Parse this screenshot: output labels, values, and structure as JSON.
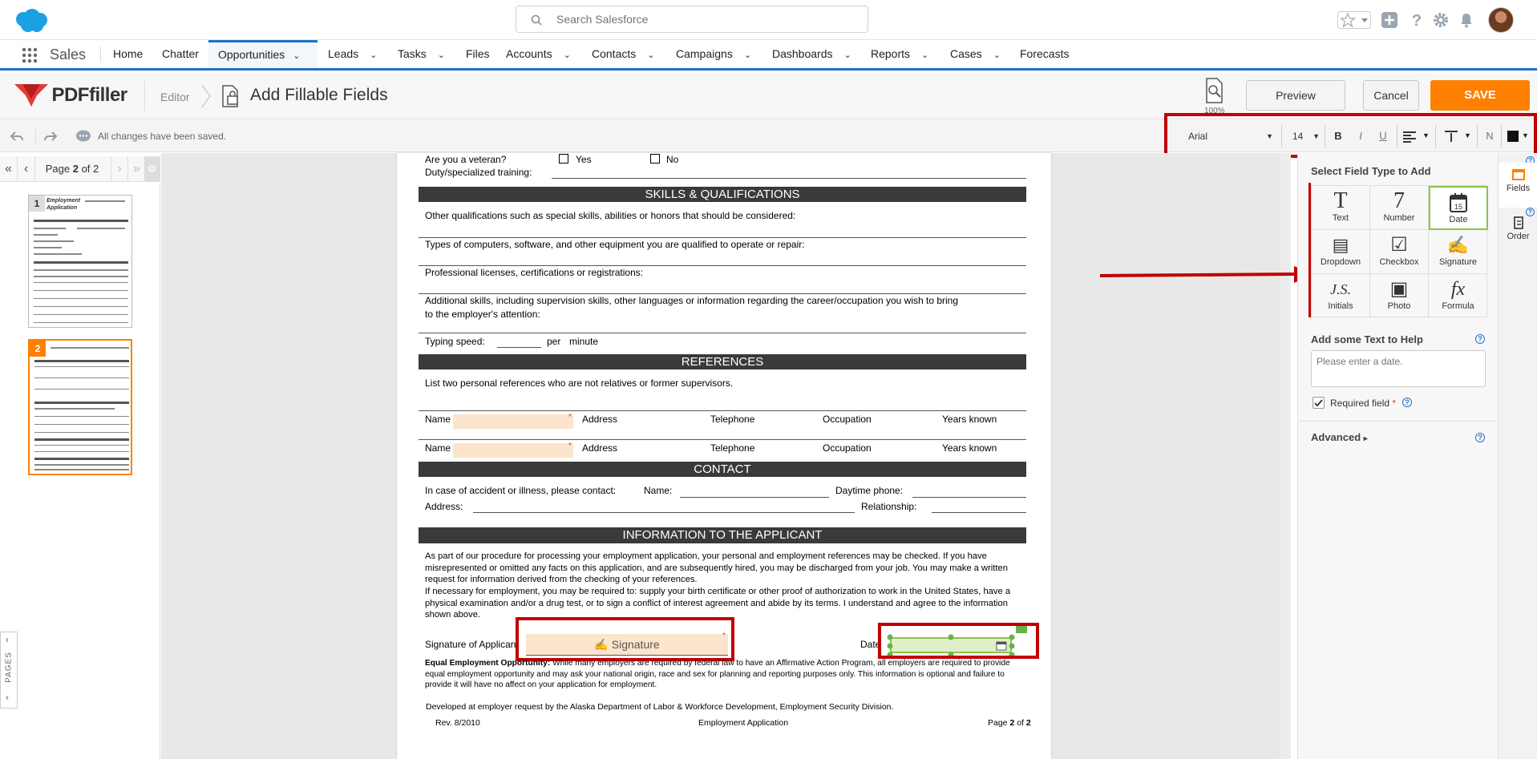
{
  "global_header": {
    "search_placeholder": "Search Salesforce",
    "icons": [
      "salesforce-cloud-icon",
      "search-icon",
      "favorites-star-icon",
      "add-plus-icon",
      "help-icon",
      "gear-icon",
      "bell-icon",
      "avatar"
    ]
  },
  "nav": {
    "app_name": "Sales",
    "items": [
      {
        "label": "Home",
        "chevron": false
      },
      {
        "label": "Chatter",
        "chevron": false
      },
      {
        "label": "Opportunities",
        "chevron": true,
        "active": true
      },
      {
        "label": "Leads",
        "chevron": true
      },
      {
        "label": "Tasks",
        "chevron": true
      },
      {
        "label": "Files",
        "chevron": false
      },
      {
        "label": "Accounts",
        "chevron": true
      },
      {
        "label": "Contacts",
        "chevron": true
      },
      {
        "label": "Campaigns",
        "chevron": true
      },
      {
        "label": "Dashboards",
        "chevron": true
      },
      {
        "label": "Reports",
        "chevron": true
      },
      {
        "label": "Cases",
        "chevron": true
      },
      {
        "label": "Forecasts",
        "chevron": false
      }
    ]
  },
  "editor_header": {
    "logo_text": "PDFfiller",
    "breadcrumb": "Editor",
    "title": "Add Fillable Fields",
    "zoom_label": "100%",
    "preview_label": "Preview",
    "cancel_label": "Cancel",
    "save_label": "SAVE"
  },
  "toolbar": {
    "status": "All changes have been saved.",
    "font": "Arial",
    "font_size": "14",
    "bold": "B",
    "italic": "I",
    "underline": "U",
    "normal": "N"
  },
  "page_nav": {
    "page_word": "Page",
    "current": "2",
    "of_word": "of",
    "total": "2",
    "pages_tab": "PAGES"
  },
  "thumbnails": [
    {
      "num": "1",
      "title": "Employment Application"
    },
    {
      "num": "2"
    }
  ],
  "document": {
    "veteran_q": "Are you a veteran?",
    "yes": "Yes",
    "no": "No",
    "duty_label": "Duty/specialized training:",
    "skills_header": "SKILLS & QUALIFICATIONS",
    "skills_lines": [
      "Other qualifications such as special skills, abilities or honors that should be considered:",
      "Types of computers, software, and other equipment you are qualified to operate or repair:",
      "Professional licenses, certifications or registrations:",
      "Additional skills, including supervision skills, other languages or information regarding the career/occupation you wish to bring",
      "to the employer's attention:"
    ],
    "typing_speed": "Typing speed:",
    "per": "per",
    "minute": "minute",
    "references_header": "REFERENCES",
    "references_intro": "List two personal references who are not relatives or former supervisors.",
    "ref_cols": [
      "Name",
      "Address",
      "Telephone",
      "Occupation",
      "Years known"
    ],
    "contact_header": "CONTACT",
    "contact_line1": "In case of accident or illness, please contact:",
    "contact_name": "Name:",
    "daytime_phone": "Daytime phone:",
    "address": "Address:",
    "relationship": "Relationship:",
    "info_header": "INFORMATION TO THE APPLICANT",
    "info_para": "As part of our procedure for processing your employment application, your personal and employment references may be checked. If you have misrepresented or omitted any facts on this application, and are subsequently hired, you may be discharged from your job. You may make a written request for information derived from the checking of your references.",
    "info_para2": "If necessary for employment, you may be required to: supply your birth certificate or other proof of authorization to work in the United States, have a physical examination and/or a drug test, or to sign a conflict of interest agreement and abide by its terms. I understand and agree to the information shown above.",
    "signature_label": "Signature of Applicant",
    "signature_field": "Signature",
    "date_label": "Date",
    "eeo_bold": "Equal Employment Opportunity:",
    "eeo_text": "While many employers are required by federal law to have an Affirmative Action Program, all employers are required to provide equal employment opportunity and may ask your national origin, race and sex for planning and reporting purposes only. This information is optional and failure to provide it will have no affect on your application for employment.",
    "developed": "Developed at employer request by the Alaska Department of Labor & Workforce Development, Employment Security Division.",
    "rev": "Rev. 8/2010",
    "footer_center": "Employment Application",
    "footer_page": "Page",
    "footer_page_num": "2",
    "footer_of": "of",
    "footer_total": "2"
  },
  "right_panel": {
    "title": "Select Field Type to Add",
    "field_types": [
      {
        "label": "Text",
        "glyph": "T"
      },
      {
        "label": "Number",
        "glyph": "7"
      },
      {
        "label": "Date",
        "glyph": "15",
        "selected": true
      },
      {
        "label": "Dropdown",
        "glyph": "▤"
      },
      {
        "label": "Checkbox",
        "glyph": "☑"
      },
      {
        "label": "Signature",
        "glyph": "✍"
      },
      {
        "label": "Initials",
        "glyph": "J.S."
      },
      {
        "label": "Photo",
        "glyph": "▣"
      },
      {
        "label": "Formula",
        "glyph": "fx"
      }
    ],
    "help_title": "Add some Text to Help",
    "help_placeholder": "Please enter a date.",
    "required_label": "Required field",
    "required_star": "*",
    "advanced_label": "Advanced",
    "advanced_chev": "▸",
    "tabs": [
      {
        "label": "Fields"
      },
      {
        "label": "Order"
      }
    ]
  },
  "colors": {
    "salesforce_blue": "#1b73c9",
    "save_orange": "#ff7f00",
    "highlight_red": "#c00000",
    "field_fill": "#fde4cc",
    "selected_green": "#8bc34a"
  }
}
